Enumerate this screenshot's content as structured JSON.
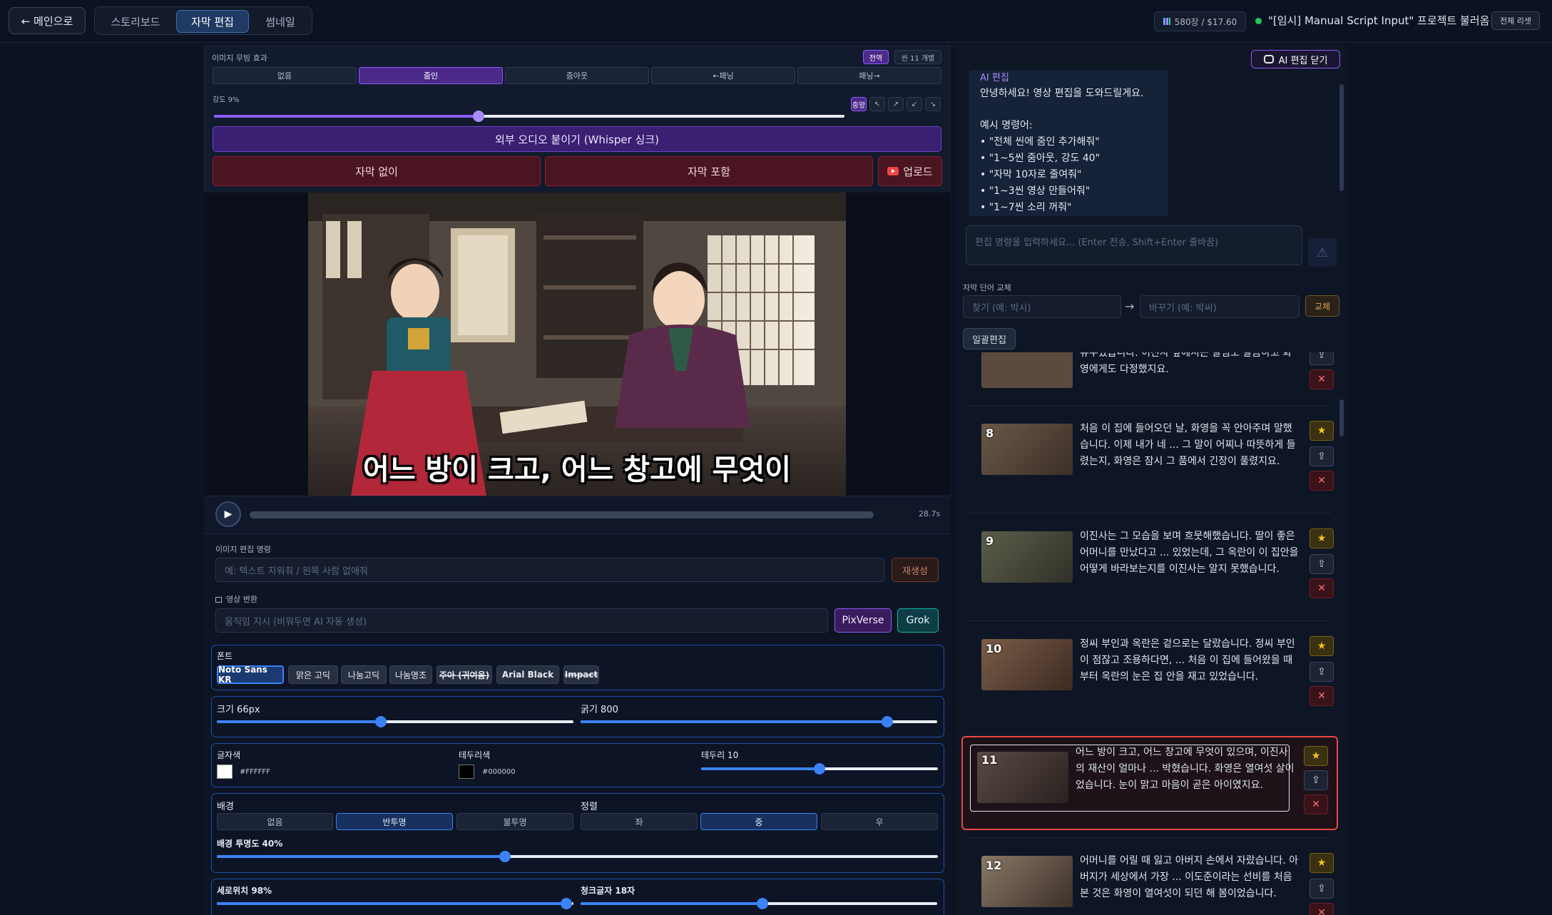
{
  "topbar": {
    "back_label": "← 메인으로",
    "tabs": [
      {
        "label": "스토리보드"
      },
      {
        "label": "자막 편집"
      },
      {
        "label": "썸네일"
      }
    ],
    "cost": "580장 / $17.60",
    "project": "\"[임시] Manual Script Input\" 프로젝트 불러옴",
    "reset_label": "전체 리셋"
  },
  "effect": {
    "title": "이미지 무빙 효과",
    "scope_all": "전역",
    "scope_scene": "씬 11 개별",
    "options": [
      "없음",
      "줌인",
      "줌아웃",
      "←패닝",
      "패닝→"
    ],
    "selected": "줌인",
    "intensity_label": "강도 9%",
    "intensity": 0.09,
    "anchor_options": [
      "중앙",
      "↖",
      "↗",
      "↙",
      "↘"
    ],
    "anchor_selected": "중앙"
  },
  "actions": {
    "whisper_label": "외부 오디오 붙이기 (Whisper 싱크)",
    "no_subtitle": "자막 없이",
    "with_subtitle": "자막 포함",
    "upload": "업로드"
  },
  "preview": {
    "caption": "어느 방이 크고, 어느 창고에 무엇이",
    "time": "28.7s"
  },
  "image_edit": {
    "label": "이미지 편집 명령",
    "placeholder": "예: 텍스트 지워줘 / 왼쪽 사람 없애줘",
    "regen_label": "재생성"
  },
  "video": {
    "label": "영상 변환",
    "placeholder": "움직임 지시 (비워두면 AI 자동 생성)",
    "pixverse": "PixVerse",
    "grok": "Grok"
  },
  "font": {
    "label": "폰트",
    "options": [
      "Noto Sans KR",
      "맑은 고딕",
      "나눔고딕",
      "나눔명조",
      "주아 (귀여움)",
      "Arial Black",
      "Impact"
    ],
    "selected": "Noto Sans KR"
  },
  "size": {
    "label": "크기 66px",
    "value": 0.46
  },
  "weight": {
    "label": "굵기 800",
    "value": 0.86
  },
  "colors": {
    "text_label": "글자색",
    "text_color": "#FFFFFF",
    "stroke_label": "테두리색",
    "stroke_color": "#000000",
    "stroke_width_label": "테두리 10",
    "stroke_width": 0.5
  },
  "background": {
    "label": "배경",
    "options": [
      "없음",
      "반투명",
      "불투명"
    ],
    "selected": "반투명",
    "align_label": "정렬",
    "align_options": [
      "좌",
      "중",
      "우"
    ],
    "align_selected": "중",
    "opacity_label": "배경 투명도 40%",
    "opacity": 0.4
  },
  "position": {
    "vertical_label": "세로위치 98%",
    "vertical": 0.98,
    "chunk_label": "청크글자 18자",
    "chunk": 0.51
  },
  "ai_panel": {
    "close_label": "AI 편집 닫기",
    "title": "AI 편집",
    "greeting": "안녕하세요! 영상 편집을 도와드릴게요.",
    "examples_title": "예시 명령어:",
    "examples": [
      "• \"전체 씬에 줌인 추가해줘\"",
      "• \"1~5씬 줌아웃, 강도 40\"",
      "• \"자막 10자로 줄여줘\"",
      "• \"1~3씬 영상 만들어줘\"",
      "• \"1~7씬 소리 꺼줘\""
    ],
    "input_placeholder": "편집 명령을 입력하세요... (Enter 전송, Shift+Enter 줄바꿈)"
  },
  "replace": {
    "label": "자막 단어 교체",
    "find_placeholder": "찾기 (예: 박시)",
    "replace_placeholder": "바꾸기 (예: 박씨)",
    "arrow": "→",
    "button": "교체",
    "bulk": "일괄편집"
  },
  "scenes": [
    {
      "num": "",
      "text": "유수였습니다. 이진사 앞에서는 살림도 말씀하고 화영에게도 다정했지요."
    },
    {
      "num": "8",
      "text": "처음 이 집에 들어오던 날, 화영을 꼭 안아주며 말했습니다. 이제 내가 네 ... 그 말이 어찌나 따뜻하게 들렸는지, 화영은 잠시 그 품에서 긴장이 풀렸지요."
    },
    {
      "num": "9",
      "text": "이진사는 그 모습을 보며 흐뭇해했습니다. 딸이 좋은 어머니를 만났다고 ... 있었는데, 그 옥란이 이 집안을 어떻게 바라보는지를 이진사는 알지 못했습니다."
    },
    {
      "num": "10",
      "text": "정씨 부인과 옥란은 겉으로는 달랐습니다. 정씨 부인이 점잖고 조용하다면, ... 처음 이 집에 들어왔을 때부터 옥란의 눈은 집 안을 재고 있었습니다."
    },
    {
      "num": "11",
      "text": "어느 방이 크고, 어느 창고에 무엇이 있으며, 이진사의 재산이 얼마나 ... 박혔습니다. 화영은 열여섯 살이었습니다. 눈이 맑고 마음이 곧은 아이였지요."
    },
    {
      "num": "12",
      "text": "어머니를 어릴 때 잃고 아버지 손에서 자랐습니다. 아버지가 세상에서 가장 ... 이도준이라는 선비를 처음 본 것은 화영이 열여섯이 되던 해 봄이었습니다."
    }
  ],
  "scene_buttons": {
    "star": "★",
    "upload": "⇪",
    "delete": "✕"
  }
}
